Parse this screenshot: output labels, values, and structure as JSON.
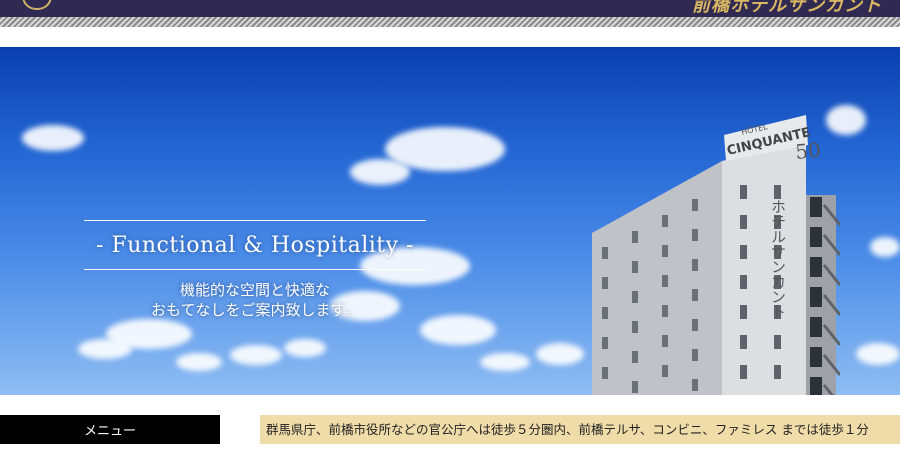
{
  "header": {
    "brand_text": "前橋ホテルサンカント",
    "colors": {
      "bar": "#302a52",
      "gold": "#d9b762"
    }
  },
  "hero": {
    "title": "- Functional & Hospitality -",
    "subtitle_lines": [
      "機能的な空間と快適な",
      "おもてなしをご案内致します。"
    ],
    "building_sign": {
      "hotel": "HOTEL",
      "name": "CINQUANTE",
      "number": "50",
      "vertical": "ホテルサンカント"
    }
  },
  "sidebar": {
    "menu_label": "メニュー"
  },
  "intro": {
    "text": "群馬県庁、前橋市役所などの官公庁へは徒歩５分圏内、前橋テルサ、コンビニ、ファミレス までは徒歩１分"
  }
}
